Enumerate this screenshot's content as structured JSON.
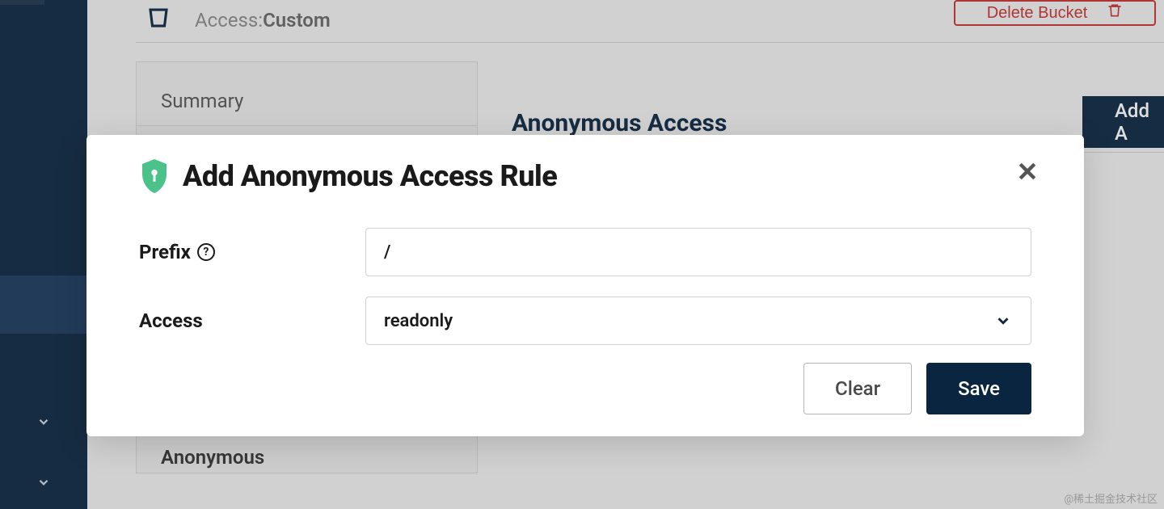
{
  "header": {
    "access_label": "Access: ",
    "access_value": "Custom",
    "delete_label": "Delete Bucket"
  },
  "panel": {
    "summary_label": "Summary",
    "anonymous_section_label": "Anonymous",
    "anonymous_access_title": "Anonymous Access",
    "add_label": "Add A"
  },
  "modal": {
    "title": "Add Anonymous Access Rule",
    "prefix_label": "Prefix",
    "prefix_value": "/",
    "access_label": "Access",
    "access_value": "readonly",
    "clear_label": "Clear",
    "save_label": "Save"
  },
  "watermark": "@稀土掘金技术社区"
}
